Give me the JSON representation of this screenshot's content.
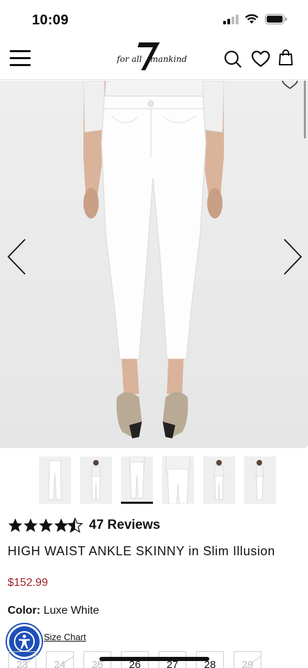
{
  "status_bar": {
    "time": "10:09"
  },
  "header": {
    "logo_text": "for all mankind",
    "logo_number": "7"
  },
  "hero": {
    "image_description": "model wearing white high waist ankle skinny jeans and snakeskin heels"
  },
  "thumbnails": [
    {
      "label": "front flat"
    },
    {
      "label": "full front"
    },
    {
      "label": "front close"
    },
    {
      "label": "back close"
    },
    {
      "label": "full back"
    },
    {
      "label": "side"
    }
  ],
  "product": {
    "rating": 4.5,
    "reviews_label": "47 Reviews",
    "title": "HIGH WAIST ANKLE SKINNY in Slim Illusion",
    "price": "$152.99",
    "color_label": "Color:",
    "color_value": "Luxe White",
    "size_chart_label": "Size Chart"
  },
  "sizes": [
    {
      "label": "23",
      "available": false
    },
    {
      "label": "24",
      "available": false
    },
    {
      "label": "25",
      "available": false
    },
    {
      "label": "26",
      "available": true
    },
    {
      "label": "27",
      "available": true
    },
    {
      "label": "28",
      "available": true
    },
    {
      "label": "29",
      "available": false
    }
  ],
  "colors": {
    "price": "#a1202a",
    "accessibility": "#1d4fb8"
  }
}
